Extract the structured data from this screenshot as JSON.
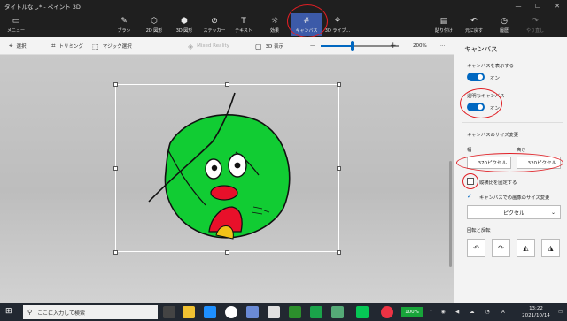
{
  "window": {
    "title": "タイトルなし* - ペイント 3D",
    "controls": {
      "minimize": "—",
      "maximize": "☐",
      "close": "✕"
    }
  },
  "ribbon": {
    "menu": "メニュー",
    "tools": [
      {
        "label": "ブラシ",
        "icon": "brush-icon",
        "glyph": "✎"
      },
      {
        "label": "2D 図形",
        "icon": "2d-shapes-icon",
        "glyph": "⬡"
      },
      {
        "label": "3D 図形",
        "icon": "3d-shapes-icon",
        "glyph": "⬢"
      },
      {
        "label": "ステッカー",
        "icon": "sticker-icon",
        "glyph": "⊘"
      },
      {
        "label": "テキスト",
        "icon": "text-icon",
        "glyph": "T"
      },
      {
        "label": "効果",
        "icon": "effects-icon",
        "glyph": "☼"
      },
      {
        "label": "キャンバス",
        "icon": "canvas-icon",
        "glyph": "#"
      },
      {
        "label": "3D ライブ...",
        "icon": "3d-library-icon",
        "glyph": "⚘"
      }
    ],
    "right": [
      {
        "label": "貼り付け",
        "icon": "paste-icon",
        "glyph": "▤"
      },
      {
        "label": "元に戻す",
        "icon": "undo-icon",
        "glyph": "↶"
      },
      {
        "label": "履歴",
        "icon": "history-icon",
        "glyph": "◷"
      },
      {
        "label": "やり直し",
        "icon": "redo-icon",
        "glyph": "↷"
      }
    ]
  },
  "toolbar": {
    "select": "選択",
    "crop": "トリミング",
    "magic_select": "マジック選択",
    "mixed_reality": "Mixed Reality",
    "view3d": "3D 表示",
    "zoom": "200%",
    "more": "···",
    "zoom_minus": "—",
    "zoom_plus": "+"
  },
  "panel": {
    "title": "キャンバス",
    "show_canvas_label": "キャンバスを表示する",
    "show_canvas_value": "オン",
    "transparent_label": "透明なキャンバス",
    "transparent_value": "オン",
    "resize_label": "キャンバスのサイズ変更",
    "width_label": "幅",
    "height_label": "高さ",
    "width_value": "370ピクセル",
    "height_value": "320ピクセル",
    "lock_ratio_label": "縦横比を固定する",
    "resize_image_label": "キャンバスでの画像のサイズ変更",
    "unit_value": "ピクセル",
    "rotate_label": "回転と反転"
  },
  "taskbar": {
    "search_placeholder": "ここに入力して検索",
    "battery": "100%",
    "ime": "A",
    "time": "13:22",
    "date": "2021/10/14"
  }
}
